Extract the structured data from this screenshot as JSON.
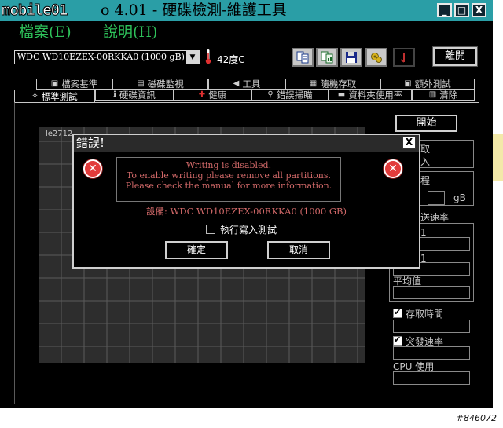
{
  "window": {
    "watermark": "mobile01",
    "title": "o 4.01 - 硬碟檢測-維護工具",
    "buttons": {
      "minimize": "_",
      "maximize": "□",
      "close": "X"
    }
  },
  "menu": {
    "items": [
      "檔案(E)",
      "說明(H)"
    ]
  },
  "toolbar": {
    "drive": "WDC WD10EZEX-00RKKA0 (1000 gB)",
    "temperature": "42度C",
    "icons": [
      "copy-icon",
      "copy-report-icon",
      "save-icon",
      "options-icon",
      "exit-door-icon"
    ],
    "exit_label": "離開"
  },
  "tabs": {
    "row1": [
      "檔案基準",
      "磁碟監視",
      "工具",
      "隨機存取",
      "額外測試"
    ],
    "row2": [
      "標準測試",
      "硬碟資訊",
      "健康",
      "錯誤掃瞄",
      "資料夾使用率",
      "清除"
    ],
    "active": "標準測試"
  },
  "graph": {
    "label": "le2712"
  },
  "side_panel": {
    "start_label": "開始",
    "partial_labels": [
      "取",
      "入",
      "程",
      "送速率",
      "1",
      "1"
    ],
    "unit": "gB",
    "average_label": "平均值",
    "access_time_label": "存取時間",
    "burst_rate_label": "突發速率",
    "cpu_usage_label": "CPU 使用"
  },
  "dialog": {
    "title": "錯誤!",
    "close_label": "X",
    "message_lines": [
      "Writing is disabled.",
      "To enable writing please remove all partitions.",
      "Please check the manual for more information."
    ],
    "device": "設備: WDC WD10EZEX-00RKKA0 (1000 GB)",
    "checkbox_label": "執行寫入測試",
    "ok_label": "確定",
    "cancel_label": "取消"
  },
  "caption": "#846072",
  "colors": {
    "titlebar": "#2a9ea6",
    "menu_text": "#2ec15a",
    "error_text": "#d06868",
    "error_icon": "#e23b3b"
  }
}
